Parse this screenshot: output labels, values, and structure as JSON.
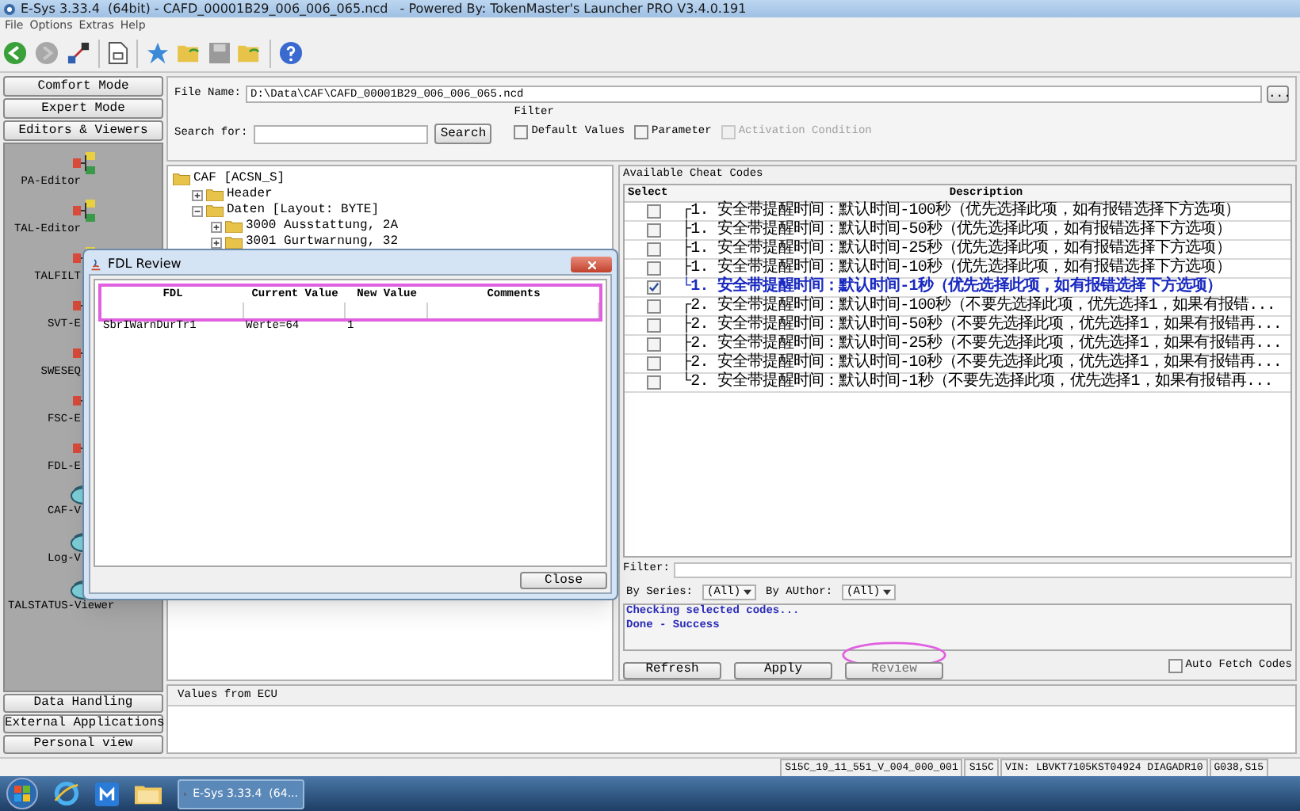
{
  "window": {
    "title": "E-Sys 3.33.4  (64bit) - CAFD_00001B29_006_006_065.ncd   - Powered By: TokenMaster's Launcher PRO V3.4.0.191"
  },
  "menu": [
    "File",
    "Options",
    "Extras",
    "Help"
  ],
  "sidebar": {
    "top_buttons": [
      "Comfort Mode",
      "Expert Mode",
      "Editors & Viewers"
    ],
    "items": [
      {
        "label": "PA-Editor",
        "kind": "editor"
      },
      {
        "label": "TAL-Editor",
        "kind": "editor"
      },
      {
        "label": "TALFILT",
        "kind": "editor"
      },
      {
        "label": "SVT-E",
        "kind": "editor"
      },
      {
        "label": "SWESEQ",
        "kind": "editor"
      },
      {
        "label": "FSC-E",
        "kind": "editor"
      },
      {
        "label": "FDL-E",
        "kind": "editor"
      },
      {
        "label": "CAF-V",
        "kind": "viewer"
      },
      {
        "label": "Log-V",
        "kind": "viewer"
      },
      {
        "label": "TALSTATUS-Viewer",
        "kind": "viewer"
      }
    ],
    "bottom_buttons": [
      "Data Handling",
      "External Applications",
      "Personal view"
    ]
  },
  "file_name": {
    "label": "File Name:",
    "value": "D:\\Data\\CAF\\CAFD_00001B29_006_006_065.ncd",
    "browse": "..."
  },
  "search": {
    "label": "Search for:",
    "button": "Search"
  },
  "filter": {
    "title": "Filter",
    "options": [
      {
        "label": "Default Values",
        "checked": false,
        "disabled": false
      },
      {
        "label": "Parameter",
        "checked": false,
        "disabled": false
      },
      {
        "label": "Activation Condition",
        "checked": false,
        "disabled": true
      }
    ]
  },
  "tree": [
    {
      "label": "CAF [ACSN_S]",
      "children": [
        {
          "label": "Header",
          "expanded": false
        },
        {
          "label": "Daten [Layout: BYTE]",
          "expanded": true,
          "children": [
            {
              "label": "3000 Ausstattung, 2A",
              "expanded": false
            },
            {
              "label": "3001 Gurtwarnung, 32",
              "expanded": false
            }
          ]
        }
      ]
    }
  ],
  "cheat_codes": {
    "title": "Available Cheat Codes",
    "columns": [
      "Select",
      "Description"
    ],
    "rows": [
      {
        "branch": "┌",
        "text": "1. 安全带提醒时间：默认时间-100秒（优先选择此项，如有报错选择下方选项）",
        "checked": false
      },
      {
        "branch": "├",
        "text": "1. 安全带提醒时间：默认时间-50秒（优先选择此项，如有报错选择下方选项）",
        "checked": false
      },
      {
        "branch": "├",
        "text": "1. 安全带提醒时间：默认时间-25秒（优先选择此项，如有报错选择下方选项）",
        "checked": false
      },
      {
        "branch": "├",
        "text": "1. 安全带提醒时间：默认时间-10秒（优先选择此项，如有报错选择下方选项）",
        "checked": false
      },
      {
        "branch": "└",
        "text": "1. 安全带提醒时间：默认时间-1秒（优先选择此项，如有报错选择下方选项）",
        "checked": true
      },
      {
        "branch": "┌",
        "text": "2. 安全带提醒时间：默认时间-100秒（不要先选择此项，优先选择1，如果有报错...",
        "checked": false
      },
      {
        "branch": "├",
        "text": "2. 安全带提醒时间：默认时间-50秒（不要先选择此项，优先选择1，如果有报错再...",
        "checked": false
      },
      {
        "branch": "├",
        "text": "2. 安全带提醒时间：默认时间-25秒（不要先选择此项，优先选择1，如果有报错再...",
        "checked": false
      },
      {
        "branch": "├",
        "text": "2. 安全带提醒时间：默认时间-10秒（不要先选择此项，优先选择1，如果有报错再...",
        "checked": false
      },
      {
        "branch": "└",
        "text": "2. 安全带提醒时间：默认时间-1秒（不要先选择此项，优先选择1，如果有报错再...",
        "checked": false
      }
    ],
    "filter_label": "Filter:",
    "series_label": "By Series:",
    "series_value": "(All)",
    "author_label": "By AUthor:",
    "author_value": "(All)",
    "log": [
      "Checking selected codes...",
      "Done - Success"
    ],
    "buttons": [
      {
        "label": "Refresh",
        "disabled": false
      },
      {
        "label": "Apply",
        "disabled": false
      },
      {
        "label": "Review",
        "disabled": true
      }
    ],
    "auto_fetch": {
      "label": "Auto Fetch Codes",
      "checked": false
    }
  },
  "values_panel": {
    "title": "Values from ECU"
  },
  "dialog": {
    "title": "FDL Review",
    "columns": [
      "FDL",
      "Current Value",
      "New Value",
      "Comments"
    ],
    "rows": [
      [
        "SbrIWarnDurTr1",
        "Werte=64",
        "1"
      ]
    ],
    "close": "Close"
  },
  "status_bar": [
    "S15C_19_11_551_V_004_000_001",
    "S15C",
    "VIN: LBVKT7105KST04924 DIAGADR10",
    "G038,S15"
  ],
  "taskbar": {
    "task": "E-Sys 3.33.4  (64..."
  }
}
